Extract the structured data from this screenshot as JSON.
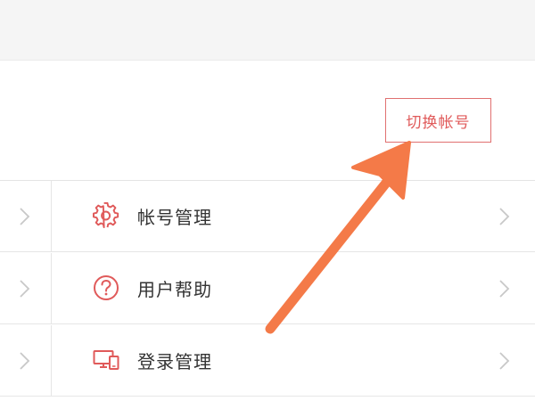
{
  "header": {
    "switch_account_label": "切换帐号"
  },
  "menu": {
    "items": [
      {
        "label": "帐号管理",
        "icon": "gear-icon"
      },
      {
        "label": "用户帮助",
        "icon": "question-circle-icon"
      },
      {
        "label": "登录管理",
        "icon": "devices-icon"
      }
    ]
  },
  "colors": {
    "accent_red": "#e05a5a",
    "annotation_arrow": "#f47a48",
    "divider": "#e6e6e6",
    "chevron": "#c8c8c8",
    "text": "#333333"
  }
}
